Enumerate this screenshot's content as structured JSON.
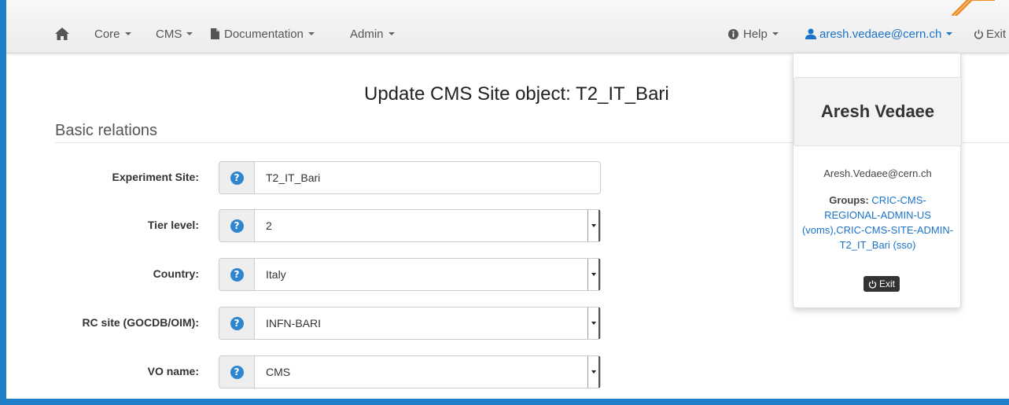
{
  "navbar": {
    "home_icon": "home-icon",
    "menus": [
      {
        "label": "Core"
      },
      {
        "label": "CMS"
      },
      {
        "label": "Documentation",
        "icon": "document-icon"
      },
      {
        "label": "Admin"
      }
    ],
    "help": {
      "label": "Help",
      "icon": "info-icon"
    },
    "user": {
      "label": "aresh.vedaee@cern.ch",
      "icon": "user-icon"
    },
    "exit": {
      "label": "Exit",
      "icon": "power-icon"
    }
  },
  "page": {
    "title": "Update CMS Site object: T2_IT_Bari",
    "section": "Basic relations"
  },
  "form": {
    "fields": [
      {
        "label": "Experiment Site:",
        "value": "T2_IT_Bari",
        "type": "input"
      },
      {
        "label": "Tier level:",
        "value": "2",
        "type": "select"
      },
      {
        "label": "Country:",
        "value": "Italy",
        "type": "select"
      },
      {
        "label": "RC site (GOCDB/OIM):",
        "value": "INFN-BARI",
        "type": "select"
      },
      {
        "label": "VO name:",
        "value": "CMS",
        "type": "select"
      }
    ],
    "help_glyph": "?"
  },
  "dropdown": {
    "name": "Aresh Vedaee",
    "email": "Aresh.Vedaee@cern.ch",
    "groups_label": "Groups:",
    "groups_value": "CRIC-CMS-REGIONAL-ADMIN-US (voms),CRIC-CMS-SITE-ADMIN-T2_IT_Bari (sso)",
    "exit_label": "Exit"
  },
  "colors": {
    "frame": "#1f7fc9",
    "link": "#1a73c9",
    "help_icon": "#2f86cf",
    "annotation_arrow": "#f08a24"
  }
}
